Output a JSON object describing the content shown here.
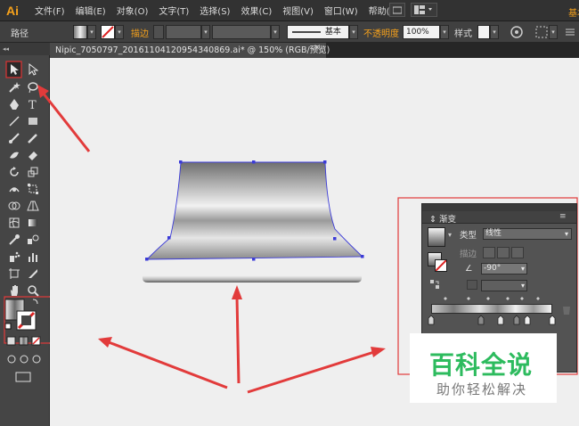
{
  "app": {
    "logo": "Ai"
  },
  "menu": [
    "文件(F)",
    "编辑(E)",
    "对象(O)",
    "文字(T)",
    "选择(S)",
    "效果(C)",
    "视图(V)",
    "窗口(W)",
    "帮助(H)"
  ],
  "menubar_right": {
    "essentials": "基本功能"
  },
  "controlbar": {
    "object_type": "路径",
    "stroke_label": "描边",
    "stroke_style": "基本",
    "opacity_label": "不透明度",
    "opacity_value": "100%",
    "style_label": "样式"
  },
  "document": {
    "tab_title": "Nipic_7050797_20161104120954340869.ai* @ 150% (RGB/预览)",
    "close": "×"
  },
  "gradient_panel": {
    "title": "渐变",
    "type_label": "类型",
    "type_value": "线性",
    "stroke_label": "描边",
    "angle_value": "-90°",
    "angle_symbol": "∠"
  },
  "watermark": {
    "title": "百科全说",
    "subtitle": "助你轻松解决"
  },
  "colors": {
    "accent_orange": "#f7a21b",
    "highlight_red": "#e23b3b",
    "path_blue": "#3b3bd8",
    "watermark_green": "#2dbb5e"
  },
  "icons": [
    "selection-tool-icon",
    "direct-selection-tool-icon",
    "magic-wand-icon",
    "lasso-icon",
    "pen-tool-icon",
    "type-tool-icon",
    "line-tool-icon",
    "rectangle-tool-icon",
    "paintbrush-icon",
    "pencil-icon",
    "blob-brush-icon",
    "eraser-icon",
    "rotate-icon",
    "scale-icon",
    "warp-icon",
    "free-transform-icon",
    "shape-builder-icon",
    "perspective-grid-icon",
    "mesh-icon",
    "gradient-tool-icon",
    "eyedropper-icon",
    "blend-icon",
    "symbol-sprayer-icon",
    "column-graph-icon",
    "artboard-icon",
    "slice-icon",
    "hand-icon",
    "zoom-icon"
  ]
}
